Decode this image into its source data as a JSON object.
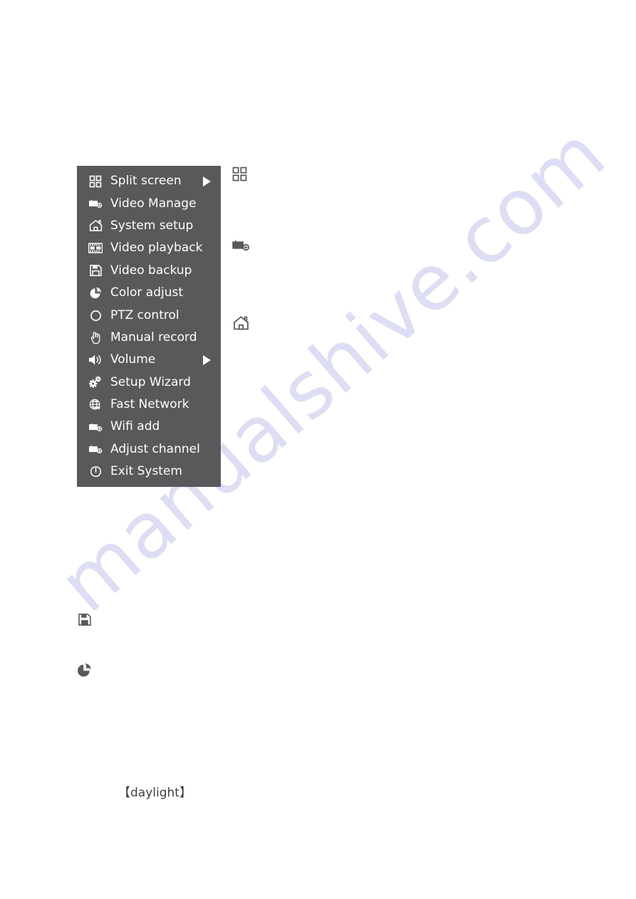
{
  "page": {
    "background_color": "#ffffff",
    "menu_background_color": "#58595b",
    "menu_text_color": "#ffffff",
    "icon_color": "#58595b",
    "watermark_color": "#dcdcf3"
  },
  "watermark": {
    "text": "manualshive.com"
  },
  "context_menu": {
    "items": [
      {
        "label": "Split screen",
        "icon": "grid-icon",
        "has_submenu": true
      },
      {
        "label": "Video Manage",
        "icon": "camera-icon",
        "has_submenu": false
      },
      {
        "label": "System setup",
        "icon": "home-icon",
        "has_submenu": false
      },
      {
        "label": "Video playback",
        "icon": "film-strip-icon",
        "has_submenu": false
      },
      {
        "label": "Video backup",
        "icon": "floppy-disk-icon",
        "has_submenu": false
      },
      {
        "label": "Color adjust",
        "icon": "pie-chart-icon",
        "has_submenu": false
      },
      {
        "label": "PTZ control",
        "icon": "circle-icon",
        "has_submenu": false
      },
      {
        "label": "Manual record",
        "icon": "hand-icon",
        "has_submenu": false
      },
      {
        "label": "Volume",
        "icon": "speaker-icon",
        "has_submenu": true
      },
      {
        "label": "Setup Wizard",
        "icon": "gears-icon",
        "has_submenu": false
      },
      {
        "label": "Fast Network",
        "icon": "globe-icon",
        "has_submenu": false
      },
      {
        "label": "Wifi add",
        "icon": "camera-icon",
        "has_submenu": false
      },
      {
        "label": "Adjust channel",
        "icon": "camera-icon",
        "has_submenu": false
      },
      {
        "label": "Exit System",
        "icon": "power-icon",
        "has_submenu": false
      }
    ]
  },
  "standalone_icons": [
    {
      "name": "grid-icon",
      "meaning": "Split screen"
    },
    {
      "name": "camera-icon",
      "meaning": "Video Manage"
    },
    {
      "name": "home-icon",
      "meaning": "System setup"
    },
    {
      "name": "floppy-disk-icon",
      "meaning": "Video backup"
    },
    {
      "name": "pie-chart-icon",
      "meaning": "Color adjust"
    }
  ],
  "caption": {
    "daylight": "【daylight】"
  }
}
